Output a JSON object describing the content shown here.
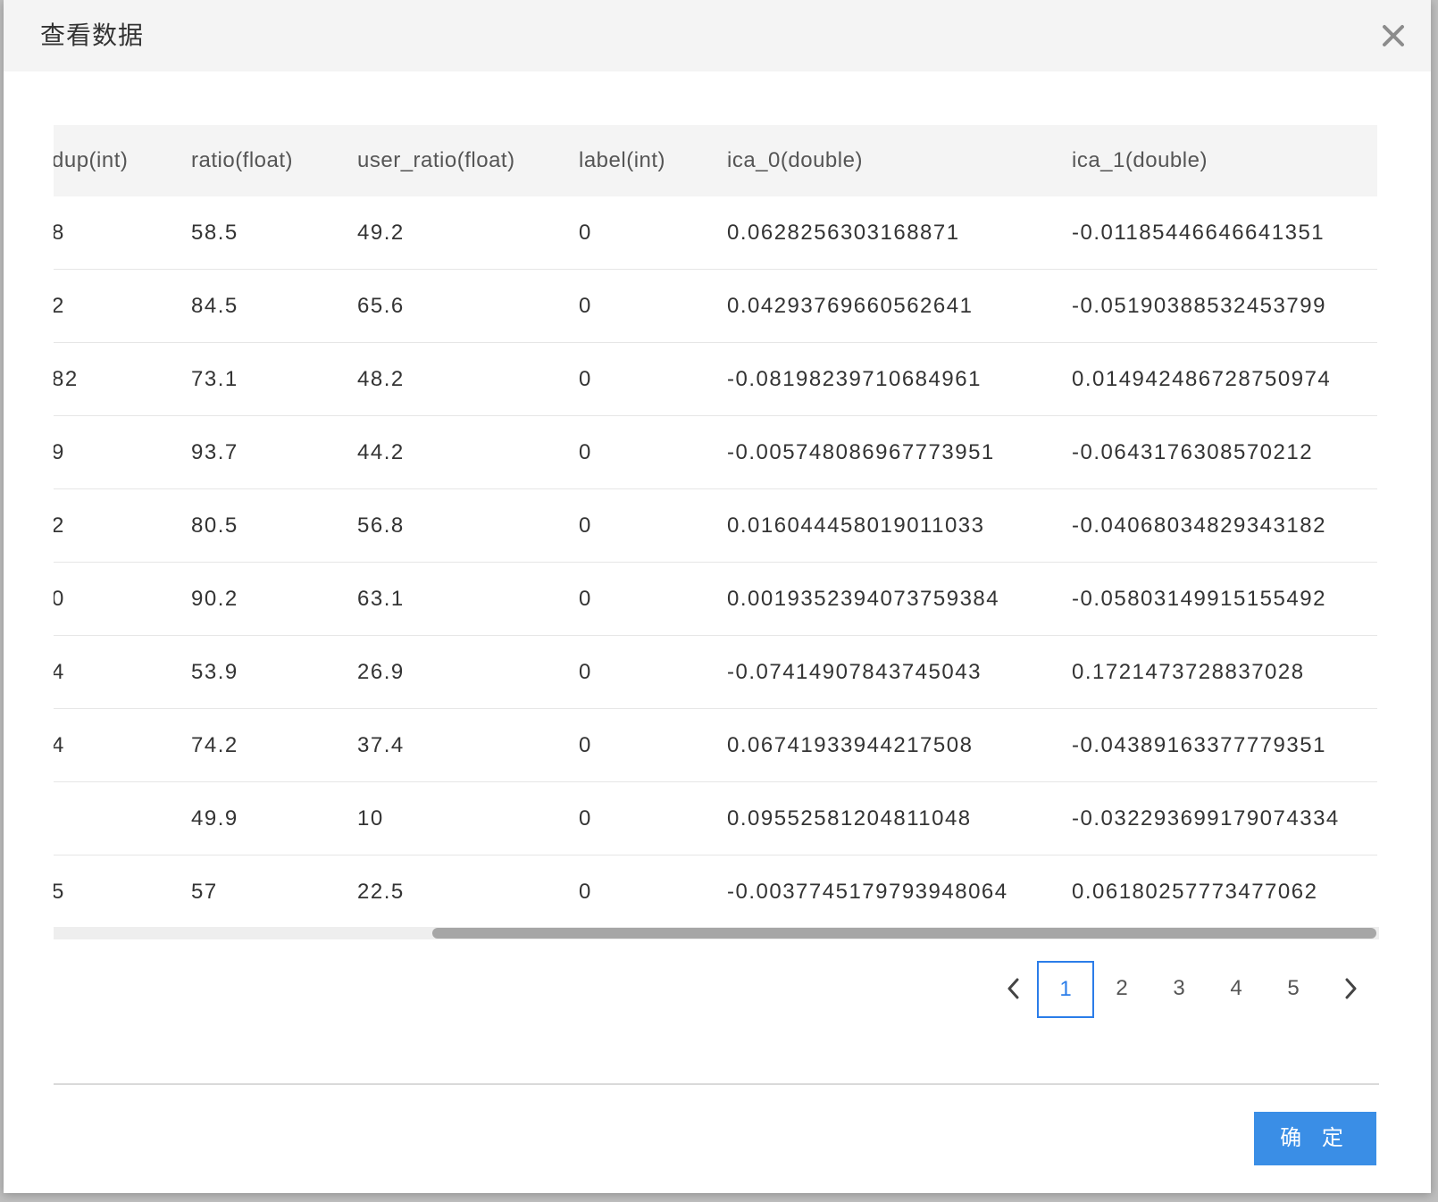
{
  "dialog": {
    "title": "查看数据",
    "confirm_label": "确 定"
  },
  "table": {
    "columns": [
      "dup(int)",
      "ratio(float)",
      "user_ratio(float)",
      "label(int)",
      "ica_0(double)",
      "ica_1(double)"
    ],
    "rows": [
      [
        "8",
        "58.5",
        "49.2",
        "0",
        "0.0628256303168871",
        "-0.01185446646641351"
      ],
      [
        "2",
        "84.5",
        "65.6",
        "0",
        "0.04293769660562641",
        "-0.05190388532453799"
      ],
      [
        "82",
        "73.1",
        "48.2",
        "0",
        "-0.08198239710684961",
        "0.014942486728750974"
      ],
      [
        "9",
        "93.7",
        "44.2",
        "0",
        "-0.005748086967773951",
        "-0.0643176308570212"
      ],
      [
        "2",
        "80.5",
        "56.8",
        "0",
        "0.016044458019011033",
        "-0.04068034829343182"
      ],
      [
        "0",
        "90.2",
        "63.1",
        "0",
        "0.0019352394073759384",
        "-0.05803149915155492"
      ],
      [
        "4",
        "53.9",
        "26.9",
        "0",
        "-0.07414907843745043",
        "0.1721473728837028"
      ],
      [
        "4",
        "74.2",
        "37.4",
        "0",
        "0.06741933944217508",
        "-0.04389163377779351"
      ],
      [
        "",
        "49.9",
        "10",
        "0",
        "0.09552581204811048",
        "-0.032293699179074334"
      ],
      [
        "5",
        "57",
        "22.5",
        "0",
        "-0.0037745179793948064",
        "0.06180257773477062"
      ]
    ]
  },
  "pagination": {
    "pages": [
      "1",
      "2",
      "3",
      "4",
      "5"
    ],
    "current": "1",
    "accent_color": "#2b7de9"
  },
  "icons": {
    "close": "close-icon",
    "prev": "chevron-left-icon",
    "next": "chevron-right-icon"
  },
  "colors": {
    "header_bg": "#f4f4f4",
    "primary_button": "#3a8ee6"
  }
}
